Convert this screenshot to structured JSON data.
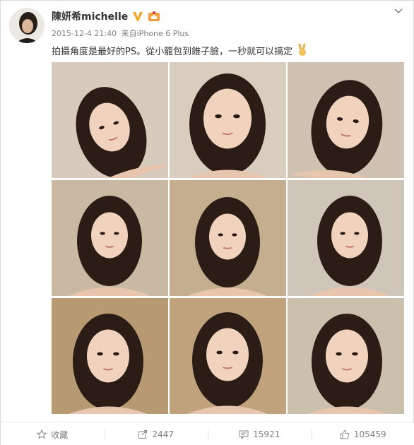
{
  "post": {
    "author": "陳妍希michelle",
    "timestamp": "2015-12-4 21:40",
    "source_prefix": "来自",
    "source_device": "iPhone 6 Plus",
    "text": "拍攝角度是最好的PS。從小籠包到錐子臉，一秒就可以搞定",
    "emoji": "victory-hand-emoji"
  },
  "photos": [
    {
      "id": "photo-1",
      "tone": "#d7cbbd"
    },
    {
      "id": "photo-2",
      "tone": "#d9cdc0"
    },
    {
      "id": "photo-3",
      "tone": "#cfc2b3"
    },
    {
      "id": "photo-4",
      "tone": "#c9b9a3"
    },
    {
      "id": "photo-5",
      "tone": "#c4ae8f"
    },
    {
      "id": "photo-6",
      "tone": "#cfc5b8"
    },
    {
      "id": "photo-7",
      "tone": "#b89a72"
    },
    {
      "id": "photo-8",
      "tone": "#c0a27c"
    },
    {
      "id": "photo-9",
      "tone": "#cbbfae"
    }
  ],
  "actions": {
    "favorite_label": "收藏",
    "repost_count": "2447",
    "comment_count": "15921",
    "like_count": "105459"
  },
  "colors": {
    "verified": "#f5a623",
    "text": "#333333",
    "muted": "#808080"
  }
}
